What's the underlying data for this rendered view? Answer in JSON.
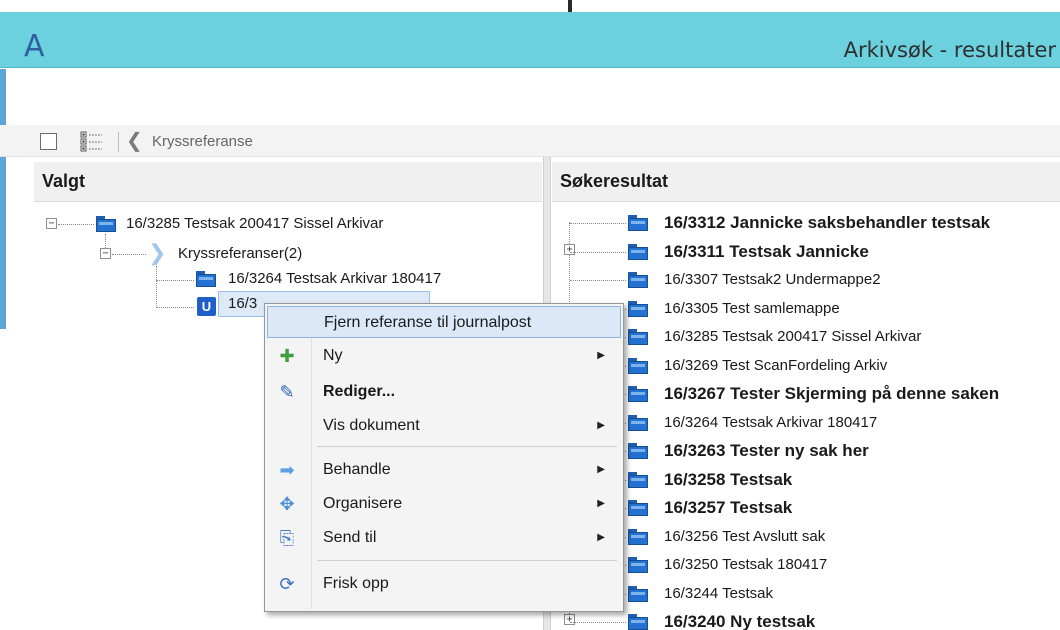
{
  "window": {
    "app_letter": "A",
    "title": "Arkivsøk - resultater"
  },
  "toolbar": {
    "breadcrumb_label": "Kryssreferanse"
  },
  "left_panel": {
    "heading": "Valgt",
    "root_label": "16/3285 Testsak 200417 Sissel Arkivar",
    "crossref_label": "Kryssreferanser(2)",
    "child1_label": "16/3264 Testsak Arkivar 180417",
    "child2_label": "16/3"
  },
  "right_panel": {
    "heading": "Søkeresultat",
    "results": [
      {
        "label": "16/3312 Jannicke saksbehandler testsak",
        "bold": true
      },
      {
        "label": "16/3311 Testsak Jannicke",
        "bold": true
      },
      {
        "label": "16/3307 Testsak2 Undermappe2",
        "bold": false
      },
      {
        "label": "16/3305 Test samlemappe",
        "bold": false
      },
      {
        "label": "16/3285 Testsak 200417 Sissel Arkivar",
        "bold": false
      },
      {
        "label": "16/3269 Test ScanFordeling Arkiv",
        "bold": false
      },
      {
        "label": "16/3267 Tester Skjerming på denne saken",
        "bold": true
      },
      {
        "label": "16/3264 Testsak Arkivar 180417",
        "bold": false
      },
      {
        "label": "16/3263 Tester ny sak her",
        "bold": true
      },
      {
        "label": "16/3258 Testsak",
        "bold": true
      },
      {
        "label": "16/3257 Testsak",
        "bold": true
      },
      {
        "label": "16/3256 Test Avslutt sak",
        "bold": false
      },
      {
        "label": "16/3250 Testsak 180417",
        "bold": false
      },
      {
        "label": "16/3244 Testsak",
        "bold": false
      },
      {
        "label": "16/3240 Ny testsak",
        "bold": true
      }
    ]
  },
  "context_menu": {
    "remove_ref": "Fjern referanse til journalpost",
    "new": "Ny",
    "edit": "Rediger...",
    "show_doc": "Vis dokument",
    "process": "Behandle",
    "organize": "Organisere",
    "send_to": "Send til",
    "refresh": "Frisk opp"
  },
  "colors": {
    "titlebar": "#6cd1df",
    "folder": "#2371d0",
    "highlight": "#dbe8f8"
  }
}
